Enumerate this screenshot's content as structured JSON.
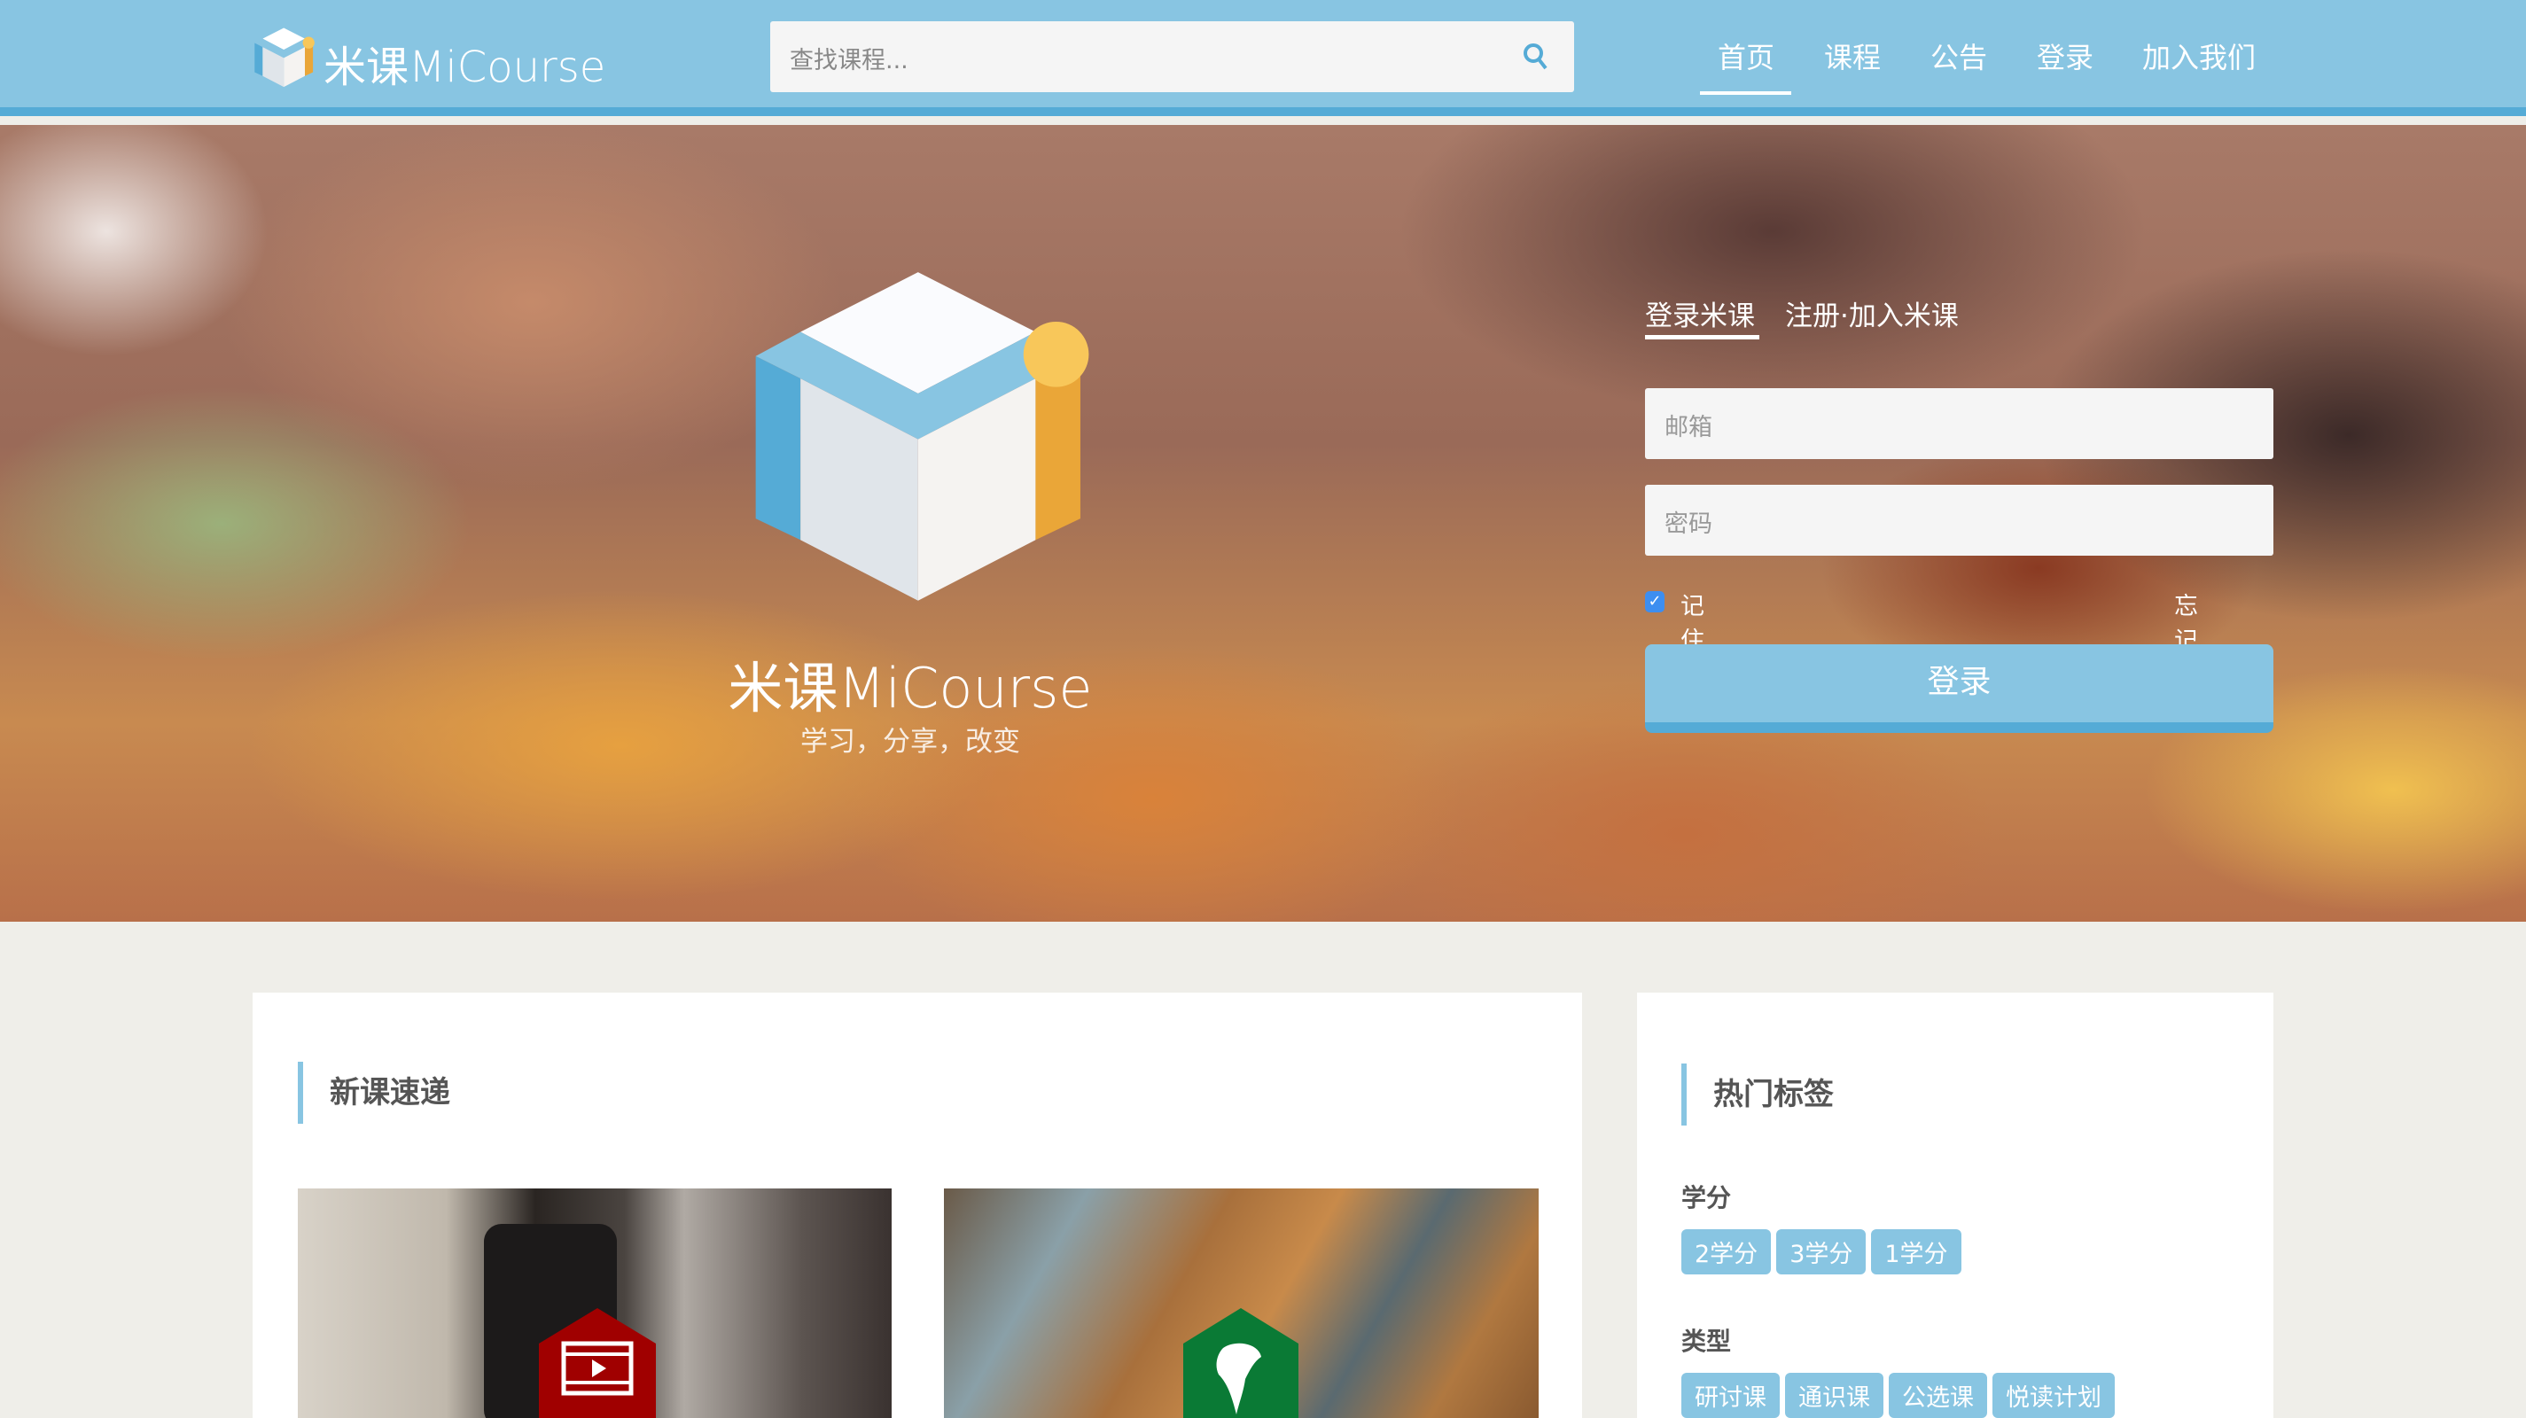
{
  "header": {
    "logo_text": "米课MiCourse",
    "search_placeholder": "查找课程...",
    "nav": [
      "首页",
      "课程",
      "公告",
      "登录",
      "加入我们"
    ],
    "active_nav": "首页"
  },
  "hero": {
    "brand": "米课MiCourse",
    "slogan": "学习，分享，改变"
  },
  "login": {
    "tabs": [
      "登录米课",
      "注册·加入米课"
    ],
    "email_placeholder": "邮箱",
    "password_placeholder": "密码",
    "remember": "记住我",
    "remember_checked": true,
    "forgot": "忘记密码",
    "submit": "登录"
  },
  "new_courses": {
    "title": "新课速递",
    "items": [
      {
        "icon": "film-play-icon",
        "color": "#a00000"
      },
      {
        "icon": "globe-icon",
        "color": "#0a7a35"
      }
    ]
  },
  "hot_tags": {
    "title": "热门标签",
    "groups": [
      {
        "label": "学分",
        "tags": [
          "2学分",
          "3学分",
          "1学分"
        ]
      },
      {
        "label": "类型",
        "tags": [
          "研讨课",
          "通识课",
          "公选课",
          "悦读计划"
        ]
      }
    ]
  },
  "colors": {
    "primary": "#88c5e2",
    "primary_dark": "#55abd6",
    "accent": "#f0a93a"
  }
}
